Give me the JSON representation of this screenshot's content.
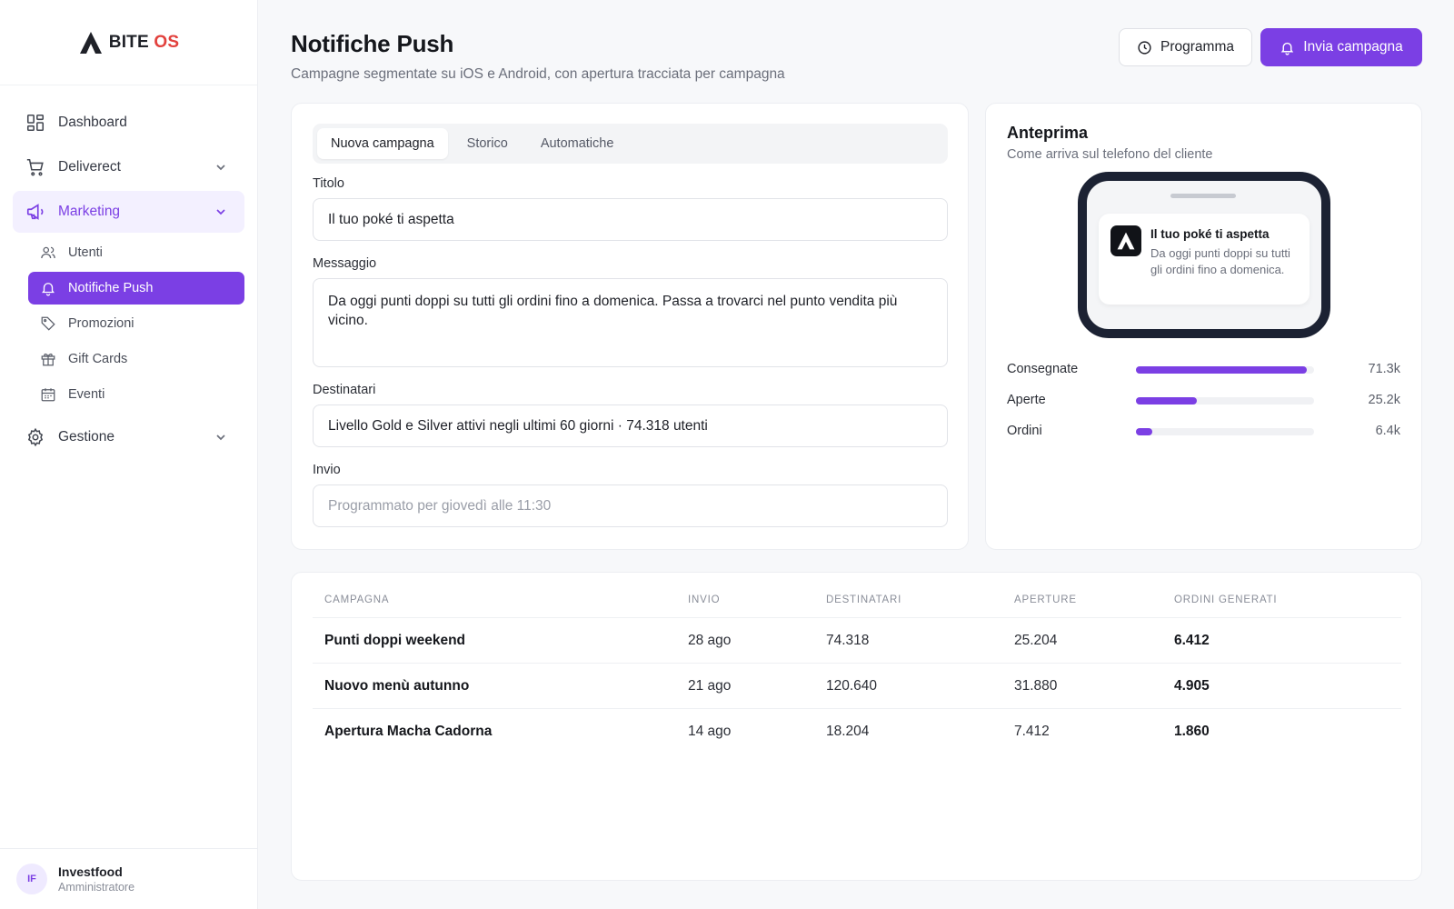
{
  "brand": {
    "name_part1": "BITE",
    "name_part2": "OS",
    "accent": "#e2413d"
  },
  "sidebar": {
    "items": [
      {
        "label": "Dashboard",
        "icon": "dashboard-icon"
      },
      {
        "label": "Deliverect",
        "icon": "cart-icon"
      },
      {
        "label": "Marketing",
        "icon": "megaphone-icon"
      },
      {
        "label": "Gestione",
        "icon": "gear-icon"
      }
    ],
    "marketing_sub": [
      {
        "label": "Utenti",
        "icon": "users-icon"
      },
      {
        "label": "Notifiche Push",
        "icon": "bell-icon"
      },
      {
        "label": "Promozioni",
        "icon": "tag-icon"
      },
      {
        "label": "Gift Cards",
        "icon": "gift-icon"
      },
      {
        "label": "Eventi",
        "icon": "calendar-icon"
      }
    ]
  },
  "user": {
    "initials": "IF",
    "name": "Investfood",
    "role": "Amministratore"
  },
  "header": {
    "title": "Notifiche Push",
    "subtitle": "Campagne segmentate su iOS e Android, con apertura tracciata per campagna",
    "schedule_label": "Programma",
    "send_label": "Invia campagna"
  },
  "form": {
    "tabs": [
      "Nuova campagna",
      "Storico",
      "Automatiche"
    ],
    "title_label": "Titolo",
    "title_value": "Il tuo poké ti aspetta",
    "message_label": "Messaggio",
    "message_value": "Da oggi punti doppi su tutti gli ordini fino a domenica. Passa a trovarci nel punto vendita più vicino.",
    "recipients_label": "Destinatari",
    "recipients_value": "Livello Gold e Silver attivi negli ultimi 60 giorni · 74.318 utenti",
    "send_label": "Invio",
    "send_placeholder": "Programmato per giovedì alle 11:30"
  },
  "preview": {
    "title": "Anteprima",
    "subtitle": "Come arriva sul telefono del cliente",
    "notif_title": "Il tuo poké ti aspetta",
    "notif_body": "Da oggi punti doppi su tutti gli ordini fino a domenica.",
    "metrics": [
      {
        "label": "Consegnate",
        "value": "71.3k",
        "fraction": 0.96
      },
      {
        "label": "Aperte",
        "value": "25.2k",
        "fraction": 0.34
      },
      {
        "label": "Ordini",
        "value": "6.4k",
        "fraction": 0.09
      }
    ],
    "accent": "#7b3fe4"
  },
  "table": {
    "headers": [
      "CAMPAGNA",
      "INVIO",
      "DESTINATARI",
      "APERTURE",
      "ORDINI GENERATI"
    ],
    "rows": [
      [
        "Punti doppi weekend",
        "28 ago",
        "74.318",
        "25.204",
        "6.412"
      ],
      [
        "Nuovo menù autunno",
        "21 ago",
        "120.640",
        "31.880",
        "4.905"
      ],
      [
        "Apertura Macha Cadorna",
        "14 ago",
        "18.204",
        "7.412",
        "1.860"
      ]
    ]
  }
}
